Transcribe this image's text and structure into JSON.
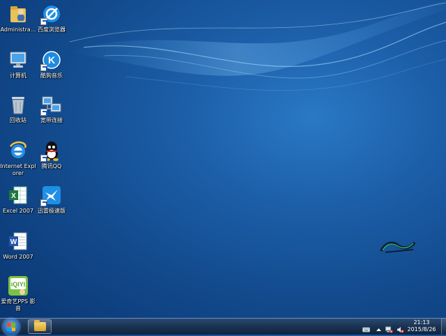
{
  "desktop": {
    "icons": [
      {
        "label": "Administra...",
        "icon": "user-folder-icon"
      },
      {
        "label": "百度浏览器",
        "icon": "baidu-browser-icon"
      },
      {
        "label": "计算机",
        "icon": "computer-icon"
      },
      {
        "label": "酷狗音乐",
        "icon": "kugou-music-icon"
      },
      {
        "label": "回收站",
        "icon": "recycle-bin-icon"
      },
      {
        "label": "宽带连接",
        "icon": "broadband-connection-icon"
      },
      {
        "label": "Internet Explorer",
        "icon": "internet-explorer-icon"
      },
      {
        "label": "腾讯QQ",
        "icon": "qq-icon"
      },
      {
        "label": "Excel 2007",
        "icon": "excel-icon"
      },
      {
        "label": "迅雷极速版",
        "icon": "xunlei-icon"
      },
      {
        "label": "Word 2007",
        "icon": "word-icon"
      },
      {
        "label": "爱奇艺PPS 影音",
        "icon": "iqiyi-pps-icon"
      }
    ]
  },
  "taskbar": {
    "start_icon": "windows-start-icon",
    "pinned_app_icon": "file-explorer-icon",
    "tray_icons": [
      "keyboard-icon",
      "show-hidden-icons-icon",
      "network-icon",
      "volume-muted-icon"
    ],
    "clock_time": "21:13",
    "clock_date": "2015/8/26"
  },
  "colors": {
    "desktop_bg": "#124a8c",
    "taskbar_bg": "#1b3454"
  }
}
